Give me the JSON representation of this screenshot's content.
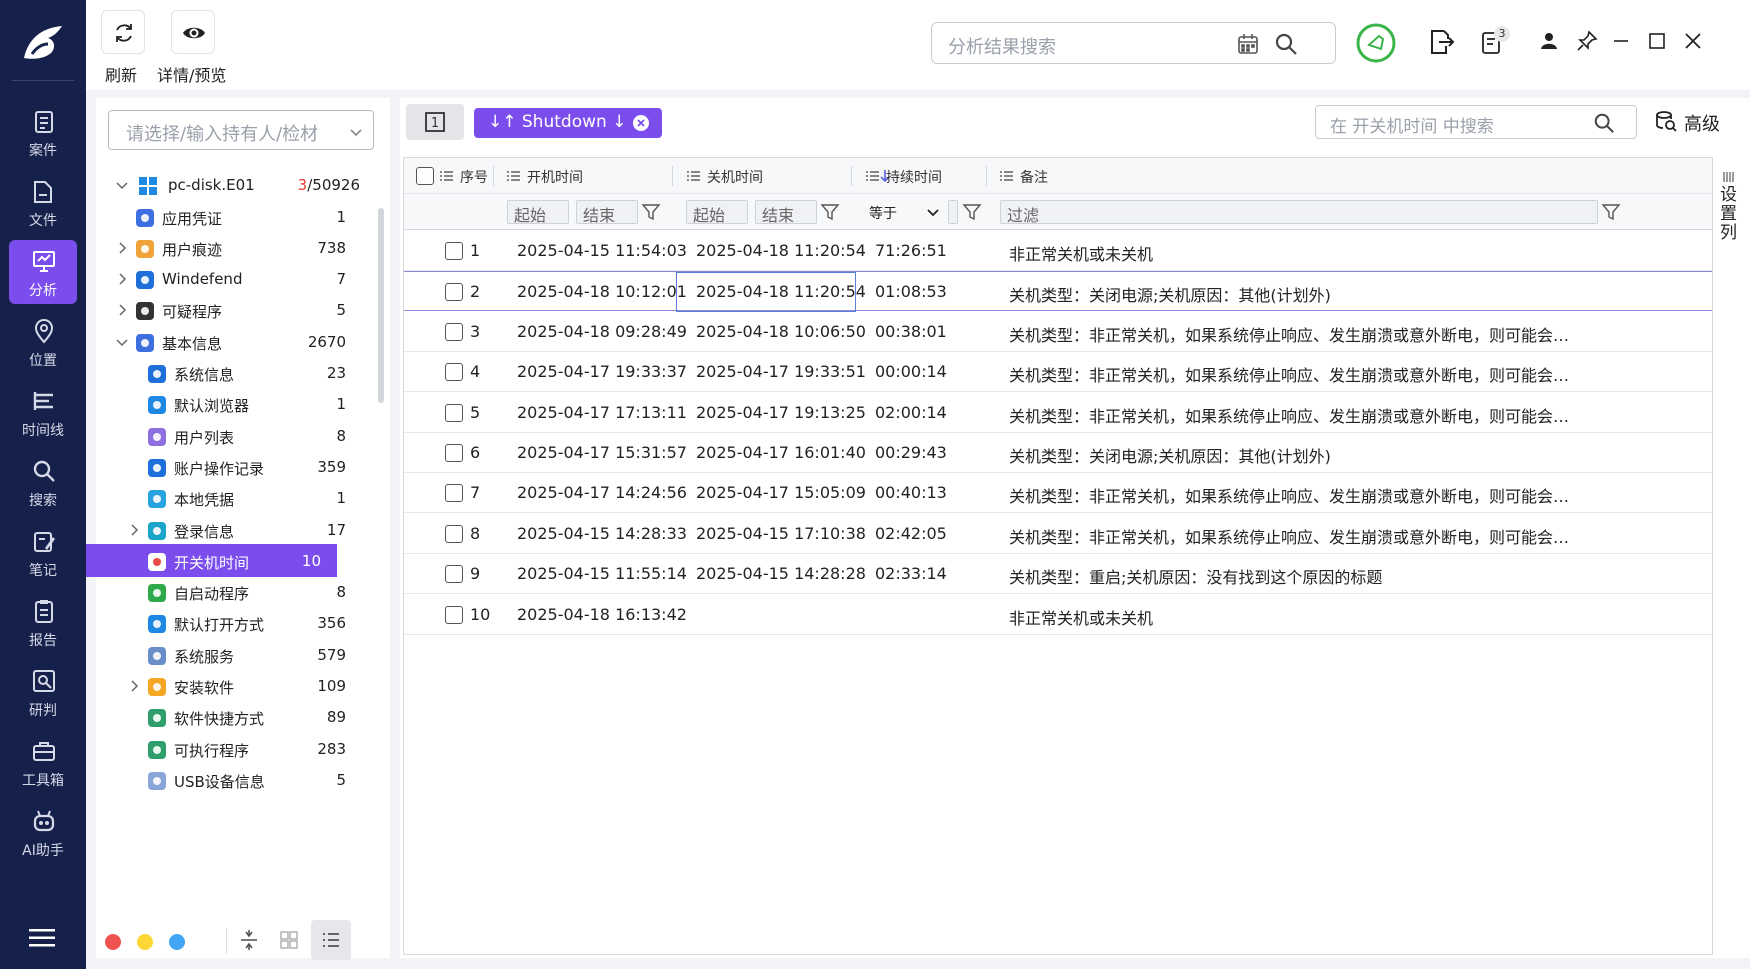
{
  "nav": {
    "items": [
      {
        "label": "案件",
        "icon": "clipboard-icon"
      },
      {
        "label": "文件",
        "icon": "folder-icon"
      },
      {
        "label": "分析",
        "icon": "monitor-icon",
        "active": true
      },
      {
        "label": "位置",
        "icon": "location-pin-icon"
      },
      {
        "label": "时间线",
        "icon": "timeline-icon"
      },
      {
        "label": "搜索",
        "icon": "search-icon"
      },
      {
        "label": "笔记",
        "icon": "note-icon"
      },
      {
        "label": "报告",
        "icon": "report-icon"
      },
      {
        "label": "研判",
        "icon": "judge-icon"
      },
      {
        "label": "工具箱",
        "icon": "toolbox-icon"
      },
      {
        "label": "AI助手",
        "icon": "robot-icon"
      }
    ]
  },
  "toolbar": {
    "refresh_label": "刷新",
    "preview_label": "详情/预览",
    "search_placeholder": "分析结果搜索",
    "badge_count": "3"
  },
  "tree": {
    "holder_placeholder": "请选择/输入持有人/检材",
    "root": {
      "label": "pc-disk.E01",
      "selected": "3",
      "total": "/50926"
    },
    "items": [
      {
        "label": "应用凭证",
        "count": "1"
      },
      {
        "label": "用户痕迹",
        "count": "738"
      },
      {
        "label": "Windefend",
        "count": "7"
      },
      {
        "label": "可疑程序",
        "count": "5"
      },
      {
        "label": "基本信息",
        "count": "2670"
      },
      {
        "label": "系统信息",
        "count": "23"
      },
      {
        "label": "默认浏览器",
        "count": "1"
      },
      {
        "label": "用户列表",
        "count": "8"
      },
      {
        "label": "账户操作记录",
        "count": "359"
      },
      {
        "label": "本地凭据",
        "count": "1"
      },
      {
        "label": "登录信息",
        "count": "17"
      },
      {
        "label": "开关机时间",
        "count": "10"
      },
      {
        "label": "自启动程序",
        "count": "8"
      },
      {
        "label": "默认打开方式",
        "count": "356"
      },
      {
        "label": "系统服务",
        "count": "579"
      },
      {
        "label": "安装软件",
        "count": "109"
      },
      {
        "label": "软件快捷方式",
        "count": "89"
      },
      {
        "label": "可执行程序",
        "count": "283"
      },
      {
        "label": "USB设备信息",
        "count": "5"
      }
    ],
    "footer_colors": [
      "#ef5350",
      "#fdd835",
      "#42a5f5"
    ]
  },
  "main": {
    "tab_label": "1",
    "chip_label": "↓↑ Shutdown ↓",
    "field_search_placeholder": "在 开关机时间 中搜索",
    "advanced_label": "高级",
    "column_settings_label": "设置列"
  },
  "table": {
    "headers": {
      "index": "序号",
      "start": "开机时间",
      "end": "关机时间",
      "duration": "持续时间",
      "note": "备注"
    },
    "filters": {
      "from": "起始",
      "to": "结束",
      "equals": "等于",
      "filter": "过滤"
    },
    "rows": [
      {
        "n": "1",
        "start": "2025-04-15 11:54:03",
        "end": "2025-04-18 11:20:54",
        "dur": "71:26:51",
        "note": "非正常关机或未关机"
      },
      {
        "n": "2",
        "start": "2025-04-18 10:12:01",
        "end": "2025-04-18 11:20:54",
        "dur": "01:08:53",
        "note": "关机类型：关闭电源;关机原因：其他(计划外)"
      },
      {
        "n": "3",
        "start": "2025-04-18 09:28:49",
        "end": "2025-04-18 10:06:50",
        "dur": "00:38:01",
        "note": "关机类型：非正常关机，如果系统停止响应、发生崩溃或意外断电，则可能会导致该类型关机"
      },
      {
        "n": "4",
        "start": "2025-04-17 19:33:37",
        "end": "2025-04-17 19:33:51",
        "dur": "00:00:14",
        "note": "关机类型：非正常关机，如果系统停止响应、发生崩溃或意外断电，则可能会导致该类型关机"
      },
      {
        "n": "5",
        "start": "2025-04-17 17:13:11",
        "end": "2025-04-17 19:13:25",
        "dur": "02:00:14",
        "note": "关机类型：非正常关机，如果系统停止响应、发生崩溃或意外断电，则可能会导致该类型关机"
      },
      {
        "n": "6",
        "start": "2025-04-17 15:31:57",
        "end": "2025-04-17 16:01:40",
        "dur": "00:29:43",
        "note": "关机类型：关闭电源;关机原因：其他(计划外)"
      },
      {
        "n": "7",
        "start": "2025-04-17 14:24:56",
        "end": "2025-04-17 15:05:09",
        "dur": "00:40:13",
        "note": "关机类型：非正常关机，如果系统停止响应、发生崩溃或意外断电，则可能会导致该类型关机"
      },
      {
        "n": "8",
        "start": "2025-04-15 14:28:33",
        "end": "2025-04-15 17:10:38",
        "dur": "02:42:05",
        "note": "关机类型：非正常关机，如果系统停止响应、发生崩溃或意外断电，则可能会导致该类型关机"
      },
      {
        "n": "9",
        "start": "2025-04-15 11:55:14",
        "end": "2025-04-15 14:28:28",
        "dur": "02:33:14",
        "note": "关机类型：重启;关机原因：没有找到这个原因的标题"
      },
      {
        "n": "10",
        "start": "2025-04-18 16:13:42",
        "end": "",
        "dur": "",
        "note": "非正常关机或未关机"
      }
    ]
  },
  "colors": {
    "accent": "#7b4ded",
    "nav_bg": "#15214a",
    "green_ring": "#3bb54a"
  }
}
